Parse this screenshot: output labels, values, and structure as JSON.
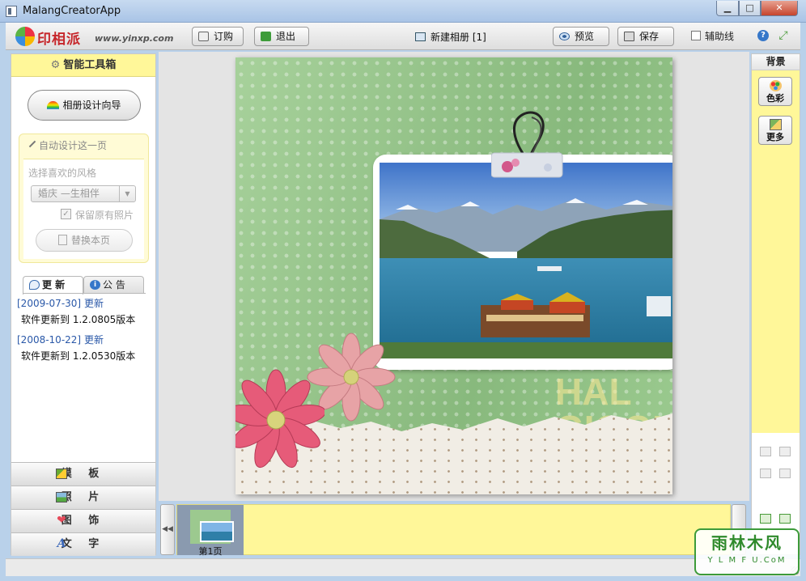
{
  "window": {
    "title": "MalangCreatorApp",
    "min_glyph": "▁",
    "max_glyph": "□",
    "close_glyph": "✕"
  },
  "toolbar": {
    "brand": "印相派",
    "url": "www.yinxp.com",
    "order_label": "订购",
    "exit_label": "退出",
    "album_title": "新建相册 [1]",
    "preview_label": "预览",
    "save_label": "保存",
    "guides_label": "辅助线",
    "help_glyph": "?",
    "expand_glyph": "⤢"
  },
  "left_panel": {
    "header": "智能工具箱",
    "gear_glyph": "⚙",
    "wizard_label": "相册设计向导",
    "auto": {
      "title": "自动设计这一页",
      "style_label": "选择喜欢的风格",
      "style_value": "婚庆 —生相伴",
      "select_glyph": "▼",
      "keep_label": "保留原有照片",
      "check_glyph": "✓",
      "replace_label": "替换本页"
    },
    "tabs": {
      "update": "更 新",
      "notice": "公 告",
      "info_glyph": "i"
    },
    "news": [
      {
        "date": "[2009-07-30]",
        "tag": "更新",
        "text": "软件更新到 1.2.0805版本"
      },
      {
        "date": "[2008-10-22]",
        "tag": "更新",
        "text": "软件更新到 1.2.0530版本"
      }
    ],
    "nav": {
      "template": "模 板",
      "photo": "照 片",
      "decor": "图 饰",
      "text": "文 字",
      "decor_glyph": "❤",
      "text_glyph": "A"
    }
  },
  "page": {
    "watermark_line1": "HAL",
    "watermark_line2": "GIGGLES"
  },
  "strip": {
    "prev_glyph": "◀◀",
    "thumb_label": "第1页"
  },
  "right_panel": {
    "header": "背景",
    "color_label": "色彩",
    "more_label": "更多"
  },
  "corner_watermark": {
    "name": "雨林木风",
    "url": "Y L M F U.CoM"
  },
  "colors": {
    "panel_yellow": "#fff799",
    "accent_blue": "#2a58a8",
    "page_green": "#95c48a"
  }
}
